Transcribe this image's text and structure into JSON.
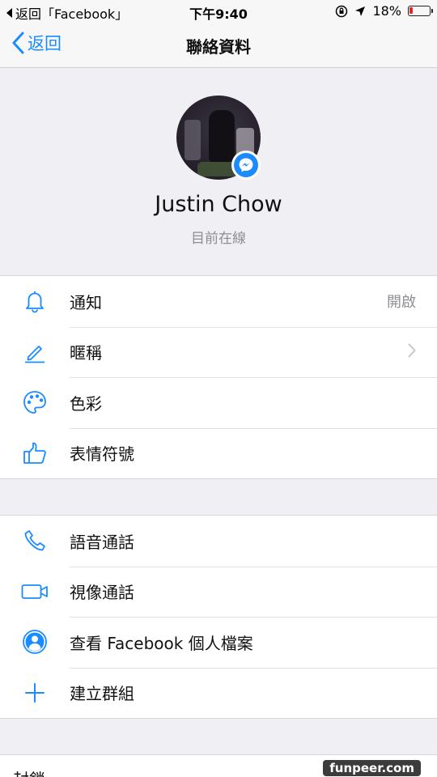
{
  "status_bar": {
    "back_app": "返回「Facebook」",
    "time": "下午9:40",
    "battery": "18%",
    "battery_level": 0.18,
    "battery_color": "#e0282b"
  },
  "nav": {
    "back_label": "返回",
    "title": "聯絡資料"
  },
  "profile": {
    "name": "Justin Chow",
    "status": "目前在線"
  },
  "section1": [
    {
      "label": "通知",
      "value": "開啟",
      "icon": "bell-icon"
    },
    {
      "label": "暱稱",
      "icon": "pencil-icon"
    },
    {
      "label": "色彩",
      "icon": "palette-icon"
    },
    {
      "label": "表情符號",
      "icon": "thumbs-up-icon"
    }
  ],
  "section2": [
    {
      "label": "語音通話",
      "icon": "phone-icon"
    },
    {
      "label": "視像通話",
      "icon": "video-camera-icon"
    },
    {
      "label": "查看 Facebook 個人檔案",
      "icon": "profile-icon"
    },
    {
      "label": "建立群組",
      "icon": "plus-icon"
    }
  ],
  "bottom": {
    "partial_label": "封鎖"
  },
  "watermark": "funpeer.com",
  "colors": {
    "accent": "#1a8cff",
    "background": "#efeff4",
    "secondary_text": "#8e8e93"
  }
}
